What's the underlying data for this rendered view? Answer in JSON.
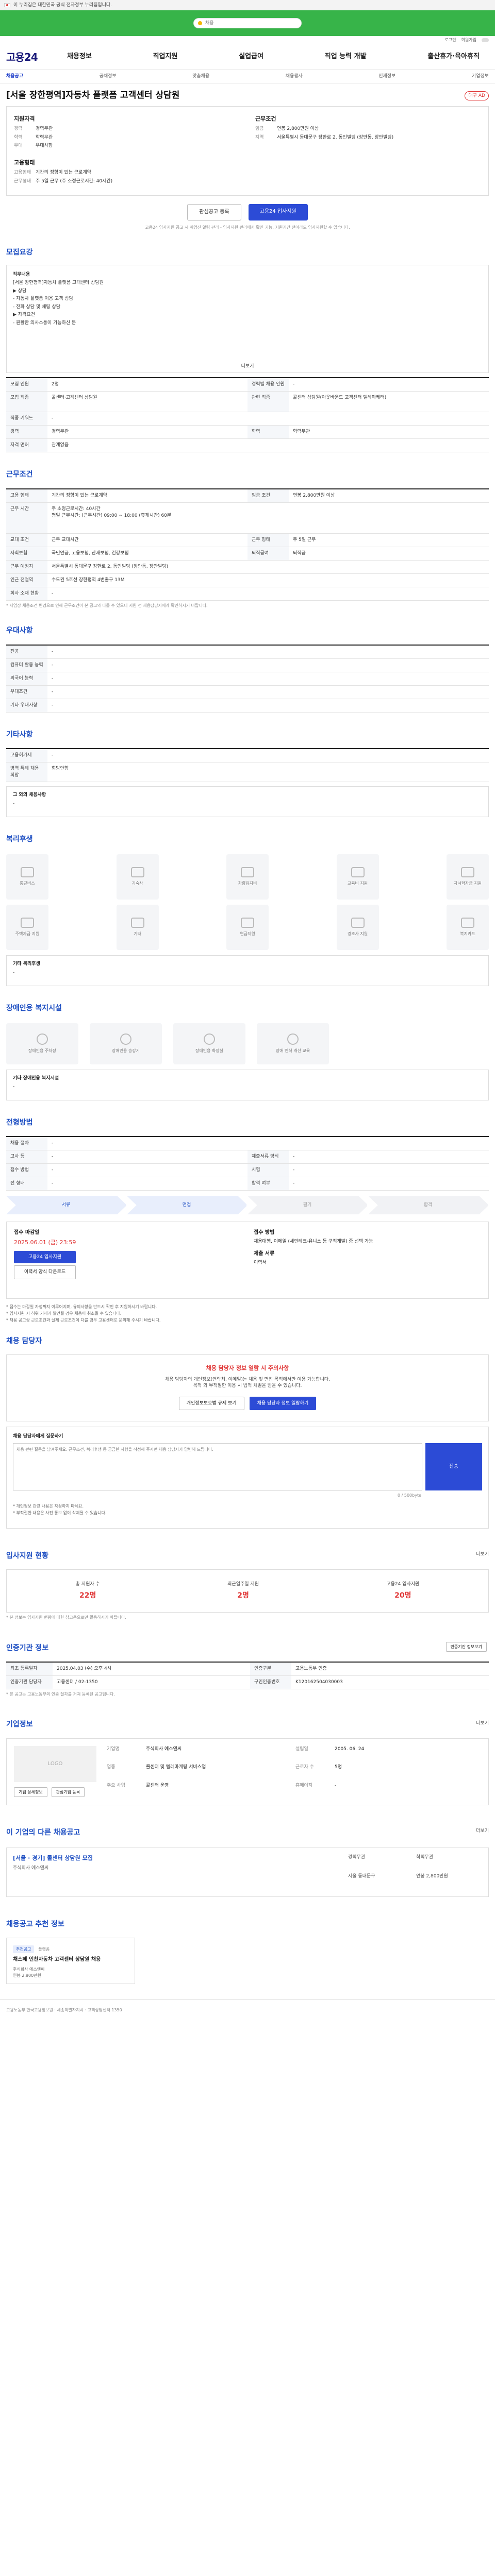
{
  "gov_banner": {
    "text": "이 누리집은 대한민국 공식 전자정부 누리집입니다."
  },
  "hero": {
    "search_placeholder": "채용"
  },
  "util": {
    "links": [
      "로그인",
      "회원가입"
    ]
  },
  "gnb": {
    "logo": "고용24",
    "menu": [
      "채용정보",
      "직업지원",
      "실업급여",
      "직업 능력 개발",
      "출산휴가·육아휴직"
    ]
  },
  "subnav": [
    "채용공고",
    "공채정보",
    "맞춤채용",
    "채용행사",
    "인재정보",
    "기업정보"
  ],
  "job": {
    "title": "[서울 장한평역]자동차 플랫폼 고객센터 상담원",
    "ad_badge": "대구 AD",
    "recruit_head": "지원자격",
    "recruit": [
      {
        "k": "경력",
        "v": "경력무관"
      },
      {
        "k": "학력",
        "v": "학력무관"
      },
      {
        "k": "우대",
        "v": "우대사항"
      }
    ],
    "cond_head": "근무조건",
    "cond": [
      {
        "k": "임금",
        "v": "연봉 2,800만원 이상"
      },
      {
        "k": "지역",
        "v": "서울특별시 동대문구 장한로 2, 동인빌딩 (장안동, 장안빌딩)"
      }
    ],
    "type_head": "고용형태",
    "types": [
      {
        "k": "고용형태",
        "v": "기간의 정함이 있는 근로계약"
      },
      {
        "k": "근무형태",
        "v": "주 5일 근무 (주 소정근로시간: 40시간)"
      }
    ],
    "btn_scrap": "관심공고 등록",
    "btn_apply": "고용24 입사지원",
    "apply_notice": "고용24 입사지원 공고 시 취업진 알림 관리 - 입사지원 관리에서 확인 가능, 지원기간 전이라도 입사지원할 수 있습니다."
  },
  "sections": {
    "mojip": "모집요강",
    "work_cond": "근무조건",
    "welfare_cond": "우대사항",
    "etc": "기타사항",
    "welfare": "복리후생",
    "disabled": "장애인용 복지시설",
    "process": "전형방법",
    "manager": "채용 담당자",
    "status": "입사지원 현황",
    "agency": "인증기관 정보",
    "company": "기업정보",
    "other": "이 기업의 다른 채용공고",
    "recommend": "채용공고 추천 정보"
  },
  "jd": {
    "label": "직무내용",
    "lines": [
      "[서울 장한평역]자동차 플랫폼 고객센터 상담원",
      "▶ 상담",
      "- 자동차 플랫폼 이용 고객 상담",
      "- 전화 상담 및 채팅 상담",
      "▶ 자격요건",
      "- 원활한 의사소통이 가능하신 분"
    ],
    "more": "더보기"
  },
  "mojip_rows": [
    {
      "k": "모집 인원",
      "v": "2명",
      "k2": "경력별 채용 인원",
      "v2": "-"
    },
    {
      "k": "모집 직종",
      "v": "콜센터·고객센터 상담원",
      "k2": "관련 직종",
      "v2": "콜센터 상담원(아웃바운드 고객센터 텔레마케터)"
    },
    {
      "k": "직종 키워드",
      "v": "-",
      "k2": "",
      "v2": ""
    },
    {
      "k": "경력",
      "v": "경력무관",
      "k2": "학력",
      "v2": "학력무관"
    },
    {
      "k": "자격 면허",
      "v": "관계없음",
      "k2": "",
      "v2": ""
    }
  ],
  "work_rows": [
    {
      "k": "고용 형태",
      "v": "기간의 정함이 있는 근로계약",
      "k2": "임금 조건",
      "v2": "연봉 2,800만원 이상"
    },
    {
      "k": "근무 시간",
      "v": "주 소정근로시간: 40시간",
      "k2": "",
      "v2": ""
    },
    {
      "k": "교대 조건",
      "v": "근무 교대시간",
      "k2": "근무 형태",
      "v2": "주 5일 근무"
    },
    {
      "k": "사회보험",
      "v": "국민연금, 고용보험, 산재보험, 건강보험",
      "k2": "퇴직급여",
      "v2": "퇴직금"
    },
    {
      "k": "근무 예정지",
      "v": "서울특별시 동대문구 장한로 2, 동인빌딩 (장안동, 장안빌딩)",
      "k2": "",
      "v2": ""
    },
    {
      "k": "인근 전철역",
      "v": "수도권 5호선 장한평역 4번출구 13M",
      "k2": "",
      "v2": ""
    },
    {
      "k": "회사 소재 현황",
      "v": "-",
      "k2": "",
      "v2": ""
    }
  ],
  "work_time_extra": "평일 근무시간: (근무시간) 09:00 ~ 18:00 (휴게시간) 60분",
  "work_note": "* 사업장 채용조건 변경으로 인해 근무조건이 본 공고와 다를 수 있으니 지원 전 채용담당자에게 확인하시기 바랍니다.",
  "pref_rows": [
    {
      "k": "전공",
      "v": "-"
    },
    {
      "k": "컴퓨터 활용 능력",
      "v": "-"
    },
    {
      "k": "외국어 능력",
      "v": "-"
    },
    {
      "k": "우대조건",
      "v": "-"
    },
    {
      "k": "기타 우대사항",
      "v": "-"
    }
  ],
  "etc_rows": [
    {
      "k": "고용허가제",
      "v": "-"
    },
    {
      "k": "병역 특례 채용 희망",
      "v": "희망안함"
    }
  ],
  "etc_box": {
    "title": "그 외의 채용사항",
    "value": "-"
  },
  "welfare_items": [
    "통근버스",
    "기숙사",
    "차량유지비",
    "교육비 지원",
    "자녀학자금 지원",
    "주택자금 지원",
    "기타",
    "연금지원",
    "경조사 지원",
    "복지카드"
  ],
  "welfare_box": {
    "title": "기타 복리후생",
    "value": "-"
  },
  "disabled_items": [
    "장애인용 주차장",
    "장애인용 승강기",
    "장애인용 화장실",
    "장애 인식 개선 교육"
  ],
  "disabled_box": {
    "title": "기타 장애인용 복지시설",
    "value": "-"
  },
  "process_rows": [
    {
      "k": "채용 절차",
      "v": "-"
    },
    {
      "k": "고사 등",
      "v": "-",
      "k2": "제출서류 양식",
      "v2": "-"
    },
    {
      "k": "접수 방법",
      "v": "-",
      "k2": "시험",
      "v2": "-"
    },
    {
      "k": "전 형태",
      "v": "-",
      "k2": "합격 여부",
      "v2": "-"
    }
  ],
  "steps": [
    "서류",
    "면접",
    "필기",
    "합격"
  ],
  "apply": {
    "period_label": "접수 마감일",
    "period": "2025.06.01 (금) 23:59",
    "btn_apply": "고용24 입사지원",
    "btn_print": "이력서 양식 다운로드",
    "method_label": "접수 방법",
    "method": "채용대행, 이메일 (세인테크·유니스 등 구직개발) 중 선택 가능",
    "docs_label": "제출 서류",
    "docs": "이력서"
  },
  "warnings": [
    "* 접수는 마감일 자정까지 이루어지며, 유의사항을 반드시 확인 후 지원하시기 바랍니다.",
    "* 입사지원 시 허위 기재가 발견될 경우 채용이 취소될 수 있습니다.",
    "* 채용 공고상 근로조건과 실제 근로조건이 다를 경우 고용센터로 문의해 주시기 바랍니다."
  ],
  "manager": {
    "alert": "채용 담당자 정보 열람 시 주의사항",
    "line1": "채용 담당자의 개인정보(연락처, 이메일)는 채용 및 면접 목적에서만 이용 가능합니다.",
    "line2": "목적 외 부적절한 이용 시 법적 처벌을 받을 수 있습니다.",
    "btn_view": "개인정보보호법 규제 보기",
    "btn_ok": "채용 담당자 정보 열람하기"
  },
  "qa": {
    "label": "채용 담당자에게 질문하기",
    "placeholder": "채용 관련 질문을 남겨주세요. 근무조건, 복리후생 등 궁금한 사항을 작성해 주시면 채용 담당자가 답변해 드립니다.",
    "send": "전송",
    "count": "0 / 500byte",
    "notes": [
      "* 개인정보 관련 내용은 작성하지 마세요.",
      "* 부적절한 내용은 사전 통보 없이 삭제될 수 있습니다."
    ]
  },
  "status": {
    "more": "더보기",
    "items": [
      {
        "label": "총 지원자 수",
        "value": "22명"
      },
      {
        "label": "최근일주일 지원",
        "value": "2명"
      },
      {
        "label": "고용24 입사지원",
        "value": "20명"
      }
    ],
    "note": "* 본 정보는 입사지원 현황에 대한 참고용으로만 활용하시기 바랍니다."
  },
  "agency": {
    "btn": "인증기관 정보보기",
    "rows": [
      {
        "k": "최초 등록일자",
        "v": "2025.04.03 (수) 오후 4시",
        "k2": "인증구분",
        "v2": "고용노동부 인증"
      },
      {
        "k": "인증기관 담당자",
        "v": "고용센터 / 02-1350",
        "k2": "구인인증번호",
        "v2": "K120162504030003"
      }
    ],
    "note": "* 본 공고는 고용노동부의 인증 절차를 거쳐 등록된 공고입니다."
  },
  "company": {
    "more": "더보기",
    "logo": "LOGO",
    "info": [
      {
        "k": "기업명",
        "v": "주식회사 에스엔씨"
      },
      {
        "k": "설립일",
        "v": "2005. 06. 24"
      },
      {
        "k": "업종",
        "v": "콜센터 및 텔레마케팅 서비스업"
      },
      {
        "k": "근로자 수",
        "v": "5명"
      },
      {
        "k": "주요 사업",
        "v": "콜센터 운영"
      },
      {
        "k": "홈페이지",
        "v": "-"
      }
    ],
    "btns": [
      "기업 상세정보",
      "관심기업 등록"
    ]
  },
  "other": {
    "more": "더보기",
    "title": "[서울 · 경기] 콜센터 상담원 모집",
    "company": "주식회사 에스엔씨",
    "meta": [
      "경력무관",
      "학력무관",
      "서울 동대문구",
      "연봉 2,800만원"
    ]
  },
  "recommend": {
    "badge": "추천공고",
    "label": "플랫폼",
    "title": "채스페 인천자동차 고객센터 상담원 채용",
    "company": "주식회사 에스엔씨",
    "wage": "연봉 2,800만원"
  },
  "footer": "고용노동부 한국고용정보원 · 세종특별자치시 · 고객상담센터 1350"
}
